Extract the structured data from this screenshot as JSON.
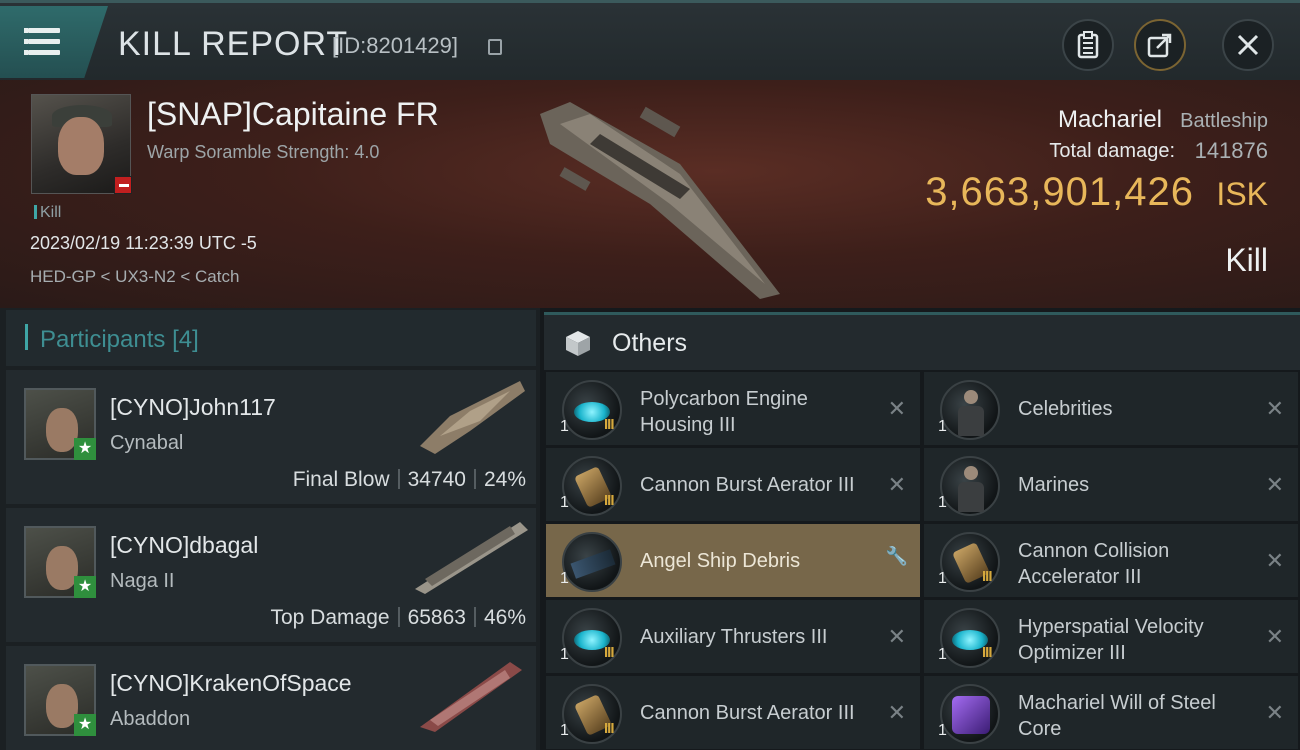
{
  "header": {
    "title": "KILL REPORT",
    "report_id": "[ID:8201429]",
    "buttons": [
      "clipboard-icon",
      "share-icon",
      "close-icon"
    ]
  },
  "victim": {
    "name": "[SNAP]Capitaine FR",
    "subtitle": "Warp Soramble Strength: 4.0",
    "tag": "Kill",
    "datetime": "2023/02/19 11:23:39 UTC -5",
    "route": "HED-GP < UX3-N2 < Catch",
    "ship_name": "Machariel",
    "ship_class": "Battleship",
    "damage_label": "Total damage:",
    "damage_value": "141876",
    "isk_value": "3,663,901,426",
    "isk_unit": "ISK",
    "result": "Kill"
  },
  "participants": {
    "title": "Participants",
    "count": "[4]",
    "list": [
      {
        "name": "[CYNO]John117",
        "ship": "Cynabal",
        "role": "Final Blow",
        "damage": "34740",
        "percent": "24%"
      },
      {
        "name": "[CYNO]dbagal",
        "ship": "Naga II",
        "role": "Top Damage",
        "damage": "65863",
        "percent": "46%"
      },
      {
        "name": "[CYNO]KrakenOfSpace",
        "ship": "Abaddon",
        "role": "",
        "damage": "",
        "percent": ""
      }
    ]
  },
  "others": {
    "title": "Others",
    "items": [
      {
        "name": "Polycarbon Engine Housing III",
        "qty": "1",
        "tier": "III",
        "icon": "thruster-icon"
      },
      {
        "name": "Celebrities",
        "qty": "1",
        "tier": "",
        "icon": "person-icon"
      },
      {
        "name": "Cannon Burst Aerator III",
        "qty": "1",
        "tier": "III",
        "icon": "cannon-icon"
      },
      {
        "name": "Marines",
        "qty": "1",
        "tier": "",
        "icon": "marine-icon"
      },
      {
        "name": "Angel Ship Debris",
        "qty": "1",
        "tier": "",
        "icon": "debris-icon"
      },
      {
        "name": "Cannon Collision Accelerator III",
        "qty": "1",
        "tier": "III",
        "icon": "cannon-icon"
      },
      {
        "name": "Auxiliary Thrusters III",
        "qty": "1",
        "tier": "III",
        "icon": "thruster-icon"
      },
      {
        "name": "Hyperspatial Velocity Optimizer III",
        "qty": "1",
        "tier": "III",
        "icon": "thruster-icon"
      },
      {
        "name": "Cannon Burst Aerator III",
        "qty": "1",
        "tier": "III",
        "icon": "cannon-icon"
      },
      {
        "name": "Machariel Will of Steel Core",
        "qty": "1",
        "tier": "",
        "icon": "core-icon"
      }
    ]
  }
}
